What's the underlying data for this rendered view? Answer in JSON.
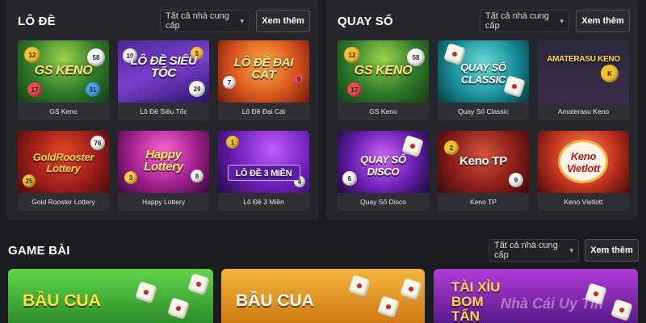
{
  "lode": {
    "title": "LÔ ĐỀ",
    "provider_filter": "Tất cả nhà cung cấp",
    "more_button": "Xem thêm",
    "games": [
      {
        "name": "GS Keno",
        "logo": "GS KENO",
        "badge": "58"
      },
      {
        "name": "Lô Đề Siêu Tốc",
        "logo": "LÔ ĐỀ SIÊU TỐC",
        "badge": "29"
      },
      {
        "name": "Lô Đề Đại Cát",
        "logo": "LÔ ĐỀ ĐẠI CÁT",
        "badge": ""
      },
      {
        "name": "Gold Rooster Lottery",
        "logo": "GoldRooster Lottery",
        "badge": "76"
      },
      {
        "name": "Happy Lottery",
        "logo": "Happy Lottery",
        "badge": ""
      },
      {
        "name": "Lô Đề 3 Miền",
        "logo": "LÔ ĐỀ 3 MIỀN",
        "badge": ""
      }
    ]
  },
  "quayso": {
    "title": "QUAY SỐ",
    "provider_filter": "Tất cả nhà cung cấp",
    "more_button": "Xem thêm",
    "games": [
      {
        "name": "GS Keno",
        "logo": "GS KENO",
        "badge": "58"
      },
      {
        "name": "Quay Số Classic",
        "logo": "QUAY SỐ CLASSIC",
        "badge": ""
      },
      {
        "name": "Amaterasu Keno",
        "logo": "AMATERASU KENO",
        "badge": ""
      },
      {
        "name": "Quay Số Disco",
        "logo": "QUAY SỐ DISCO",
        "badge": ""
      },
      {
        "name": "Keno TP",
        "logo": "Keno TP",
        "badge": ""
      },
      {
        "name": "Keno Vietlott",
        "logo": "Keno Vietlott",
        "badge": ""
      }
    ]
  },
  "gamebai": {
    "title": "GAME BÀI",
    "provider_filter": "Tất cả nhà cung cấp",
    "more_button": "Xem thêm",
    "games": [
      {
        "logo": "BẦU CUA"
      },
      {
        "logo": "BẦU CUA"
      },
      {
        "logo": "TÀI XỈU BOM TẤN"
      }
    ]
  },
  "watermark": "Nhà Cái Uy Tín",
  "colors": {
    "page_bg": "#1c1d21",
    "panel_bg": "#26272c",
    "caption_bg": "#2f3036"
  }
}
